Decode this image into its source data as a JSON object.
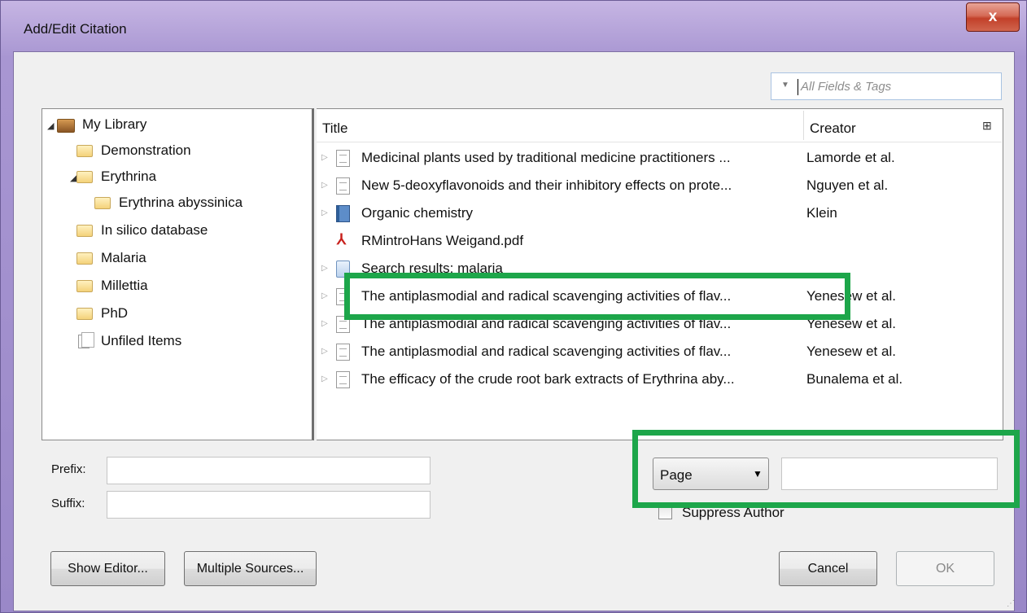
{
  "window": {
    "title": "Add/Edit Citation",
    "close_label": "x"
  },
  "search": {
    "placeholder": "All Fields & Tags",
    "dropdown_glyph": "▼"
  },
  "tree": [
    {
      "label": "My Library",
      "icon": "library-icon",
      "expander": "◢"
    },
    {
      "label": "Demonstration",
      "icon": "folder-icon"
    },
    {
      "label": "Erythrina",
      "icon": "folder-icon",
      "expander": "◢"
    },
    {
      "label": "Erythrina abyssinica",
      "icon": "folder-icon"
    },
    {
      "label": "In silico database",
      "icon": "folder-icon"
    },
    {
      "label": "Malaria",
      "icon": "folder-icon"
    },
    {
      "label": "Millettia",
      "icon": "folder-icon"
    },
    {
      "label": "PhD",
      "icon": "folder-icon"
    },
    {
      "label": "Unfiled Items",
      "icon": "unfiled-icon"
    }
  ],
  "items": {
    "columns": {
      "title": "Title",
      "creator": "Creator",
      "picker_glyph": "⊞"
    },
    "rows": [
      {
        "title": "Medicinal plants used by traditional medicine practitioners ...",
        "creator": "Lamorde et al.",
        "icon": "document-icon",
        "expander": "▷"
      },
      {
        "title": "New 5-deoxyflavonoids and their inhibitory effects on prote...",
        "creator": "Nguyen et al.",
        "icon": "document-icon",
        "expander": "▷"
      },
      {
        "title": "Organic chemistry",
        "creator": "Klein",
        "icon": "book-icon",
        "expander": "▷"
      },
      {
        "title": "RMintroHans Weigand.pdf",
        "creator": "",
        "icon": "pdf-icon",
        "expander": ""
      },
      {
        "title": "Search results: malaria",
        "creator": "",
        "icon": "webpage-icon",
        "expander": "▷"
      },
      {
        "title": "The antiplasmodial and radical scavenging activities of flav...",
        "creator": "Yenesew et al.",
        "icon": "document-icon",
        "expander": "▷"
      },
      {
        "title": "The antiplasmodial and radical scavenging activities of flav...",
        "creator": "Yenesew et al.",
        "icon": "document-icon",
        "expander": "▷"
      },
      {
        "title": "The antiplasmodial and radical scavenging activities of flav...",
        "creator": "Yenesew et al.",
        "icon": "document-icon",
        "expander": "▷"
      },
      {
        "title": "The efficacy of the crude root bark extracts of Erythrina aby...",
        "creator": "Bunalema et al.",
        "icon": "document-icon",
        "expander": "▷"
      }
    ]
  },
  "form": {
    "prefix_label": "Prefix:",
    "prefix_value": "",
    "suffix_label": "Suffix:",
    "suffix_value": "",
    "locator_selected": "Page",
    "locator_value": "",
    "suppress_author_label": "Suppress Author",
    "suppress_author_checked": false
  },
  "buttons": {
    "show_editor": "Show Editor...",
    "multiple_sources": "Multiple Sources...",
    "cancel": "Cancel",
    "ok": "OK"
  },
  "colors": {
    "highlight": "#1da64a",
    "title_bar": "#a896d2",
    "close_button": "#c2402a"
  }
}
